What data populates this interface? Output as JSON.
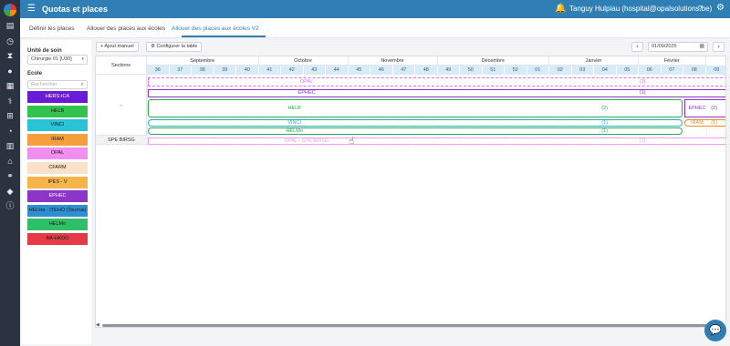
{
  "header": {
    "title": "Quotas et places",
    "user": "Tanguy Hulpiau (hospital@opalsolutions.be)",
    "menu_icon": "☰",
    "bell_icon": "🔔",
    "help_icon": "?",
    "settings_icon": "⚙"
  },
  "tabs": [
    {
      "label": "Définir les places",
      "active": false
    },
    {
      "label": "Allouer des places aux écoles",
      "active": false
    },
    {
      "label": "Allouer des places aux écoles V2",
      "active": true
    }
  ],
  "rail": {
    "icons": [
      "file-icon",
      "clock-icon",
      "hourglass-icon",
      "circle-icon",
      "calendar-icon",
      "stethoscope-icon",
      "dumbbell-icon",
      "pie-chart-icon",
      "book-icon",
      "bank-icon",
      "network-icon",
      "tags-icon",
      "info-icon"
    ]
  },
  "filters": {
    "unit_label": "Unité de soin",
    "unit_value": "Chirurgie 01 [U30]",
    "school_label": "Ecole",
    "search_placeholder": "Rechercher"
  },
  "schools": [
    {
      "name": "HERS-ICA",
      "color": "#6a1bd6",
      "text": "#ffffff"
    },
    {
      "name": "HELB",
      "color": "#33c24d",
      "text": "#1b1b1b"
    },
    {
      "name": "VINCI",
      "color": "#29c3d6",
      "text": "#1b1b1b"
    },
    {
      "name": "IRAM",
      "color": "#f59e3c",
      "text": "#1b1b1b"
    },
    {
      "name": "OPAL",
      "color": "#f08ff0",
      "text": "#1b1b1b"
    },
    {
      "name": "CFARM",
      "color": "#fbe1c8",
      "text": "#1b1b1b"
    },
    {
      "name": "IPES - V",
      "color": "#f5b54b",
      "text": "#1b1b1b"
    },
    {
      "name": "EPHEC",
      "color": "#8e35c9",
      "text": "#ffffff"
    },
    {
      "name": "HELHa - ITEHO (Tournai)",
      "color": "#2f8fd1",
      "text": "#1b1b1b"
    },
    {
      "name": "HELMo",
      "color": "#2fbf68",
      "text": "#1b1b1b"
    },
    {
      "name": "BA-HKDO",
      "color": "#e53945",
      "text": "#1b1b1b"
    }
  ],
  "toolbar": {
    "add_label": "+ Ajout manuel",
    "config_label": "⚙ Configurer la table",
    "date_value": "01/09/2025",
    "prev_icon": "‹",
    "next_icon": "›"
  },
  "grid": {
    "sections_header": "Sections",
    "months": [
      {
        "name": "Septembre",
        "span": 5
      },
      {
        "name": "Octobre",
        "span": 4
      },
      {
        "name": "Novembre",
        "span": 4
      },
      {
        "name": "Décembre",
        "span": 5
      },
      {
        "name": "Janvier",
        "span": 4
      },
      {
        "name": "Février",
        "span": 3
      }
    ],
    "weeks": [
      "36",
      "37",
      "38",
      "39",
      "40",
      "41",
      "42",
      "43",
      "44",
      "45",
      "46",
      "47",
      "48",
      "49",
      "50",
      "51",
      "52",
      "01",
      "02",
      "03",
      "04",
      "05",
      "06",
      "07",
      "08",
      "09"
    ],
    "rows": [
      {
        "section": "-",
        "bars": [
          {
            "name": "OPAL",
            "count": "(3)",
            "color": "#e96fe9",
            "start": 0,
            "end": 26,
            "dashed": true
          },
          {
            "name": "EPHEC",
            "count": "(1)",
            "color": "#8e35c9",
            "start": 0,
            "end": 26,
            "dashed": false
          },
          {
            "name": "HELB",
            "count": "(2)",
            "color": "#2ea84a",
            "start": 0,
            "end": 24,
            "dashed": false
          },
          {
            "name": "EPHEC",
            "count": "(2)",
            "color": "#8e35c9",
            "start": 24,
            "end": 26,
            "dashed": false
          },
          {
            "name": "VINCI",
            "count": "(1)",
            "color": "#1fb3c6",
            "start": 0,
            "end": 24,
            "dashed": false
          },
          {
            "name": "HELMo",
            "count": "(1)",
            "color": "#2fa860",
            "start": 0,
            "end": 24,
            "dashed": false
          },
          {
            "name": "IRAM",
            "count": "(1)",
            "color": "#f08a24",
            "start": 24,
            "end": 26,
            "dashed": false
          }
        ]
      },
      {
        "section": "SPE BIRSG",
        "bars": [
          {
            "name": "OPAL - SPE BIRSG",
            "count": "(1)",
            "color": "#f29ef2",
            "start": 0,
            "end": 26,
            "dashed": false
          }
        ]
      }
    ]
  },
  "chat_icon": "💬"
}
